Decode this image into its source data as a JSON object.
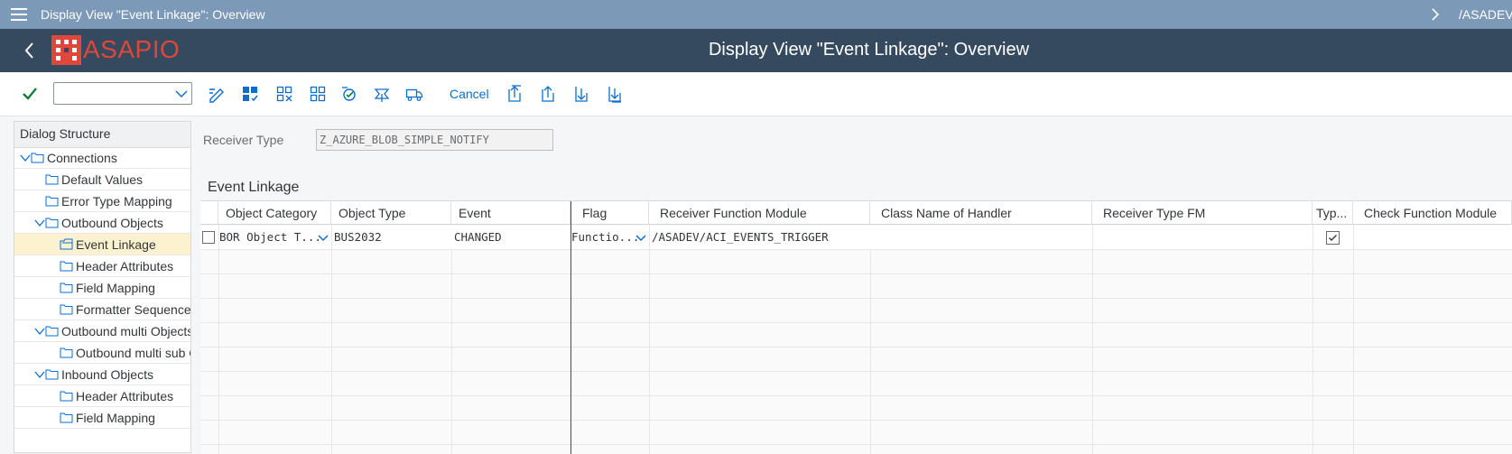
{
  "window": {
    "title": "Display View \"Event Linkage\": Overview",
    "right_text": "/ASADEV"
  },
  "shell": {
    "brand": "ASAPIO",
    "title": "Display View \"Event Linkage\": Overview"
  },
  "toolbar": {
    "command_value": "",
    "cancel_label": "Cancel",
    "icons": [
      "checkmark-icon",
      "command-dropdown-icon",
      "display-change-icon",
      "select-all-icon",
      "deselect-all-icon",
      "select-block-icon",
      "check-icon",
      "where-used-icon",
      "transport-icon",
      "first-page-icon",
      "previous-page-icon",
      "next-page-icon",
      "last-page-icon"
    ]
  },
  "dialog": {
    "title": "Dialog Structure",
    "items": [
      {
        "label": "Connections",
        "level": 0,
        "expanded": true,
        "selected": false
      },
      {
        "label": "Default Values",
        "level": 1,
        "expanded": null,
        "selected": false
      },
      {
        "label": "Error Type Mapping",
        "level": 1,
        "expanded": null,
        "selected": false
      },
      {
        "label": "Outbound  Objects",
        "level": 1,
        "expanded": true,
        "selected": false
      },
      {
        "label": "Event Linkage",
        "level": 2,
        "expanded": null,
        "selected": true
      },
      {
        "label": "Header Attributes",
        "level": 2,
        "expanded": null,
        "selected": false
      },
      {
        "label": "Field Mapping",
        "level": 2,
        "expanded": null,
        "selected": false
      },
      {
        "label": "Formatter Sequence",
        "level": 2,
        "expanded": null,
        "selected": false
      },
      {
        "label": "Outbound multi Objects",
        "level": 1,
        "expanded": true,
        "selected": false
      },
      {
        "label": "Outbound multi sub C",
        "level": 2,
        "expanded": null,
        "selected": false
      },
      {
        "label": "Inbound Objects",
        "level": 1,
        "expanded": true,
        "selected": false
      },
      {
        "label": "Header Attributes",
        "level": 2,
        "expanded": null,
        "selected": false
      },
      {
        "label": "Field Mapping",
        "level": 2,
        "expanded": null,
        "selected": false
      }
    ]
  },
  "receiver": {
    "label": "Receiver Type",
    "value": "Z_AZURE_BLOB_SIMPLE_NOTIFY"
  },
  "event_linkage": {
    "title": "Event Linkage",
    "columns": [
      "Object Category",
      "Object Type",
      "Event",
      "Flag",
      "Receiver Function Module",
      "Class Name of Handler",
      "Receiver Type FM",
      "Typ...",
      "Check Function Module"
    ],
    "rows": [
      {
        "object_category": "BOR Object T...",
        "object_type": "BUS2032",
        "event": "CHANGED",
        "flag": "Functio...",
        "receiver_fm": "/ASADEV/ACI_EVENTS_TRIGGER",
        "class_handler": "",
        "receiver_type_fm": "",
        "typ_checked": true,
        "check_fm": ""
      }
    ]
  },
  "colors": {
    "topbar": "#7d99b8",
    "shell": "#354a5f",
    "brand": "#e0473b",
    "accent": "#0a6ed1",
    "selection": "#fcf2cf",
    "check_green": "#107e3e"
  }
}
